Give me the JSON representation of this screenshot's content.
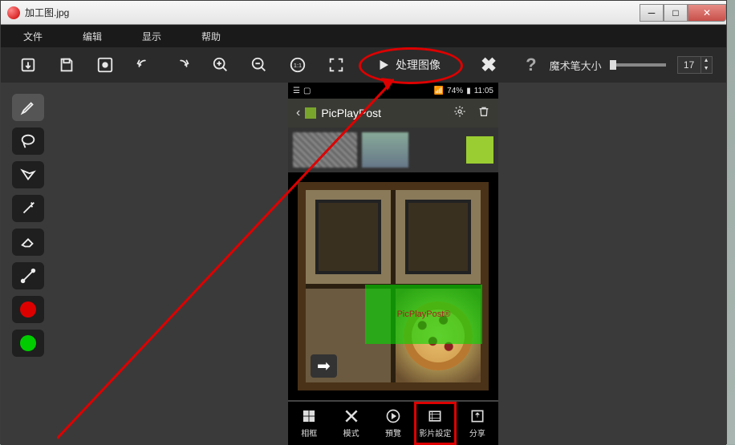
{
  "window": {
    "title": "加工图.jpg"
  },
  "menu": {
    "file": "文件",
    "edit": "编辑",
    "view": "显示",
    "help": "帮助"
  },
  "toolbar": {
    "process_label": "处理图像",
    "brush_label": "魔术笔大小",
    "brush_value": "17"
  },
  "phone": {
    "status": {
      "battery": "74%",
      "time": "11:05"
    },
    "app_title": "PicPlayPost",
    "watermark": "PicPlayPost®",
    "tabs": [
      "相框",
      "模式",
      "預覽",
      "影片設定",
      "分享"
    ]
  }
}
